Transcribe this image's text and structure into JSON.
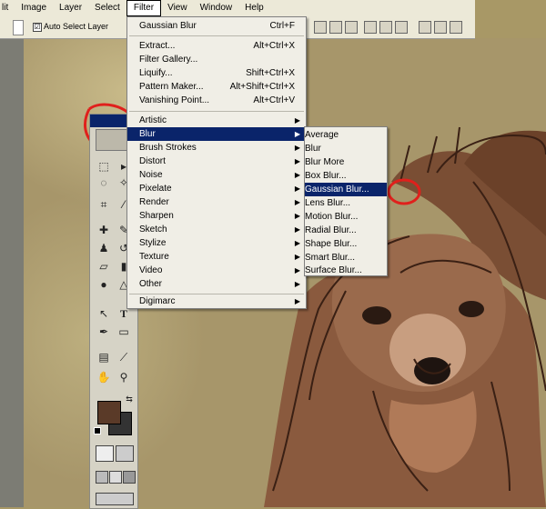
{
  "menubar": {
    "items": [
      "lit",
      "Image",
      "Layer",
      "Select",
      "Filter",
      "View",
      "Window",
      "Help"
    ]
  },
  "options": {
    "auto_select_label": "Auto Select Layer",
    "auto_select_checked": "☑"
  },
  "filter_menu": {
    "last_filter": {
      "label": "Gaussian Blur",
      "shortcut": "Ctrl+F"
    },
    "group1": [
      {
        "label": "Extract...",
        "shortcut": "Alt+Ctrl+X"
      },
      {
        "label": "Filter Gallery...",
        "shortcut": ""
      },
      {
        "label": "Liquify...",
        "shortcut": "Shift+Ctrl+X"
      },
      {
        "label": "Pattern Maker...",
        "shortcut": "Alt+Shift+Ctrl+X"
      },
      {
        "label": "Vanishing Point...",
        "shortcut": "Alt+Ctrl+V"
      }
    ],
    "categories": [
      "Artistic",
      "Blur",
      "Brush Strokes",
      "Distort",
      "Noise",
      "Pixelate",
      "Render",
      "Sharpen",
      "Sketch",
      "Stylize",
      "Texture",
      "Video",
      "Other"
    ],
    "digimarc": "Digimarc",
    "highlighted": "Blur"
  },
  "blur_submenu": {
    "items": [
      "Average",
      "Blur",
      "Blur More",
      "Box Blur...",
      "Gaussian Blur...",
      "Lens Blur...",
      "Motion Blur...",
      "Radial Blur...",
      "Shape Blur...",
      "Smart Blur...",
      "Surface Blur..."
    ],
    "highlighted": "Gaussian Blur..."
  },
  "colors": {
    "highlight": "#0a246a",
    "annotation_red": "#e0201c",
    "foreground": "#5a3a28",
    "background": "#333333"
  }
}
